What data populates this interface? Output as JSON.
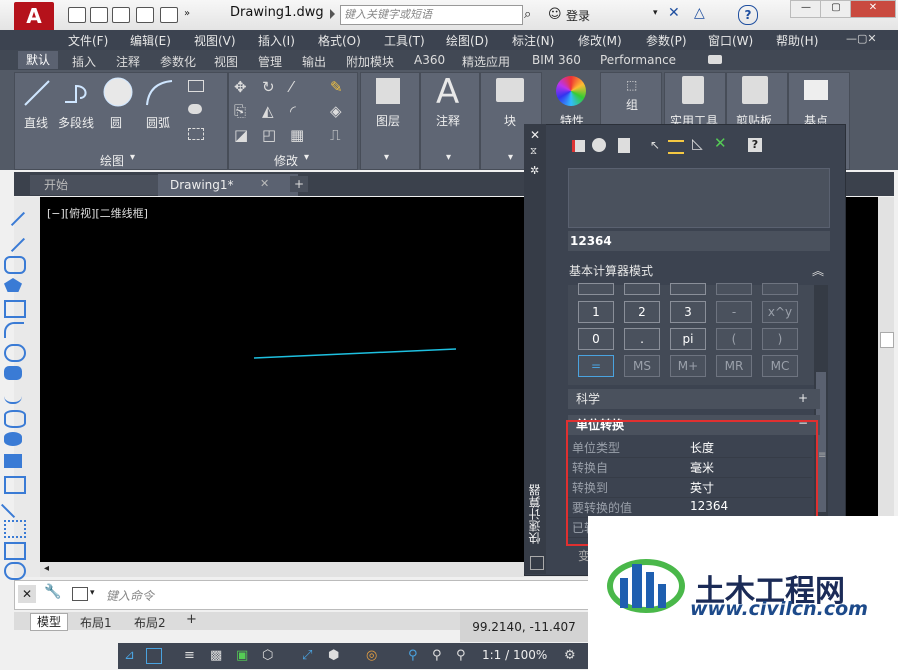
{
  "titlebar": {
    "logo": "A",
    "file_title": "Drawing1.dwg",
    "search_placeholder": "键入关键字或短语",
    "login": "登录",
    "help": "?"
  },
  "menu": [
    "文件(F)",
    "编辑(E)",
    "视图(V)",
    "插入(I)",
    "格式(O)",
    "工具(T)",
    "绘图(D)",
    "标注(N)",
    "修改(M)",
    "参数(P)",
    "窗口(W)",
    "帮助(H)"
  ],
  "ribbon_tabs": {
    "active": "默认",
    "tabs": [
      "插入",
      "注释",
      "参数化",
      "视图",
      "管理",
      "输出",
      "附加模块",
      "A360",
      "精选应用",
      "BIM 360",
      "Performance"
    ]
  },
  "ribbon": {
    "draw_tools": [
      "直线",
      "多段线",
      "圆",
      "圆弧"
    ],
    "draw_panel": "绘图",
    "modify_panel": "修改",
    "big_tools": [
      "图层",
      "注释",
      "块",
      "特性",
      "组",
      "实用工具",
      "剪贴板",
      "基点"
    ]
  },
  "doc_tabs": {
    "start": "开始",
    "drawing": "Drawing1*",
    "add": "+"
  },
  "view_label": "[−][俯视][二维线框]",
  "command": {
    "placeholder": "键入命令"
  },
  "layout_tabs": [
    "模型",
    "布局1",
    "布局2"
  ],
  "coords": "99.2140, -11.407",
  "status": {
    "scale": "1:1 / 100%"
  },
  "quickcalc": {
    "input": "12364",
    "mode_label": "基本计算器模式",
    "keys": [
      [
        "1",
        "2",
        "3",
        "-",
        "x^y"
      ],
      [
        "0",
        ".",
        "pi",
        "(",
        ")"
      ],
      [
        "=",
        "MS",
        "M+",
        "MR",
        "MC"
      ]
    ],
    "sci_label": "科学",
    "unit_label": "单位转换",
    "unit_rows": [
      {
        "label": "单位类型",
        "value": "长度"
      },
      {
        "label": "转换自",
        "value": "毫米"
      },
      {
        "label": "转换到",
        "value": "英寸"
      },
      {
        "label": "要转换的值",
        "value": "12364"
      },
      {
        "label": "已转",
        "value": ""
      }
    ],
    "bottom_row_label": "变",
    "vertical_title": "快速计算器",
    "plus": "+",
    "minus": "−"
  },
  "watermark": {
    "title": "土木工程网",
    "url": "www.civilcn.com"
  },
  "colors": {
    "accent": "#4aa3e0",
    "highlight": "#e03030",
    "canvas": "#000000",
    "logo": "#b5121b"
  }
}
